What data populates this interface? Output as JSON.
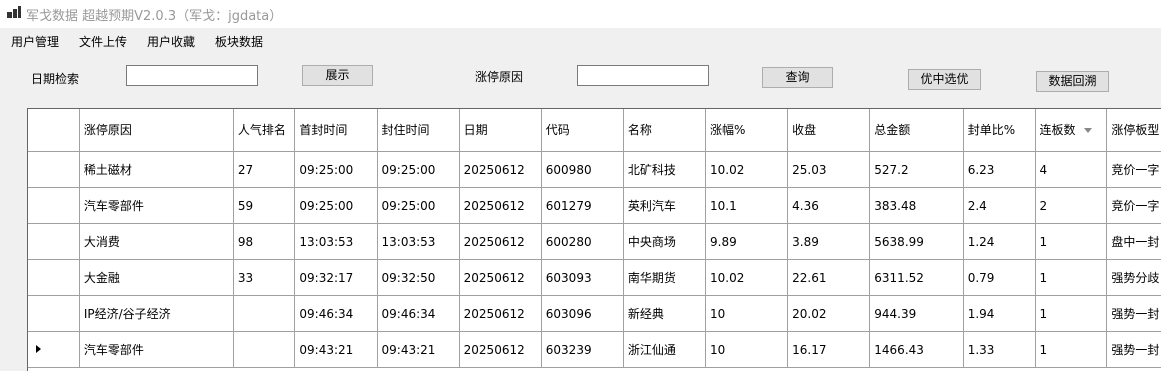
{
  "window": {
    "title": "军戈数据 超越预期V2.0.3（军戈：jgdata）"
  },
  "menu": [
    "用户管理",
    "文件上传",
    "用户收藏",
    "板块数据"
  ],
  "search": {
    "date_label": "日期检索",
    "date_value": "",
    "show_button": "展示",
    "reason_label": "涨停原因",
    "reason_value": "",
    "query_button": "查询",
    "pick_button": "优中选优",
    "backtest_button": "数据回溯"
  },
  "table": {
    "columns": [
      "涨停原因",
      "人气排名",
      "首封时间",
      "封住时间",
      "日期",
      "代码",
      "名称",
      "涨幅%",
      "收盘",
      "总金额",
      "封单比%",
      "连板数",
      "涨停板型"
    ],
    "rows": [
      [
        "稀土磁材",
        "27",
        "09:25:00",
        "09:25:00",
        "20250612",
        "600980",
        "北矿科技",
        "10.02",
        "25.03",
        "527.2",
        "6.23",
        "4",
        "竞价一字"
      ],
      [
        "汽车零部件",
        "59",
        "09:25:00",
        "09:25:00",
        "20250612",
        "601279",
        "英利汽车",
        "10.1",
        "4.36",
        "383.48",
        "2.4",
        "2",
        "竞价一字"
      ],
      [
        "大消费",
        "98",
        "13:03:53",
        "13:03:53",
        "20250612",
        "600280",
        "中央商场",
        "9.89",
        "3.89",
        "5638.99",
        "1.24",
        "1",
        "盘中一封"
      ],
      [
        "大金融",
        "33",
        "09:32:17",
        "09:32:50",
        "20250612",
        "603093",
        "南华期货",
        "10.02",
        "22.61",
        "6311.52",
        "0.79",
        "1",
        "强势分歧"
      ],
      [
        "IP经济/谷子经济",
        "",
        "09:46:34",
        "09:46:34",
        "20250612",
        "603096",
        "新经典",
        "10",
        "20.02",
        "944.39",
        "1.94",
        "1",
        "强势一封"
      ],
      [
        "汽车零部件",
        "",
        "09:43:21",
        "09:43:21",
        "20250612",
        "603239",
        "浙江仙通",
        "10",
        "16.17",
        "1466.43",
        "1.33",
        "1",
        "强势一封"
      ]
    ],
    "current_row": 5
  }
}
